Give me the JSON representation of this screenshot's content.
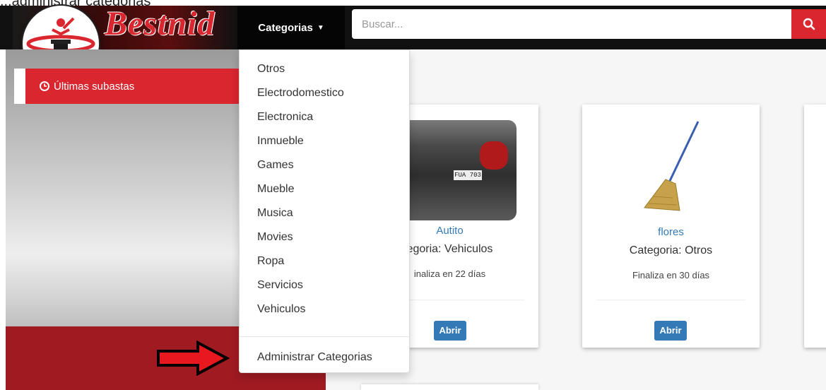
{
  "caption_fragment": "...administrar categorias",
  "brand": {
    "name": "Bestnid"
  },
  "navbar": {
    "categories_label": "Categorias",
    "search_placeholder": "Buscar..."
  },
  "sidebar": {
    "latest_label": "Últimas subastas"
  },
  "dropdown": {
    "items": [
      "Otros",
      "Electrodomestico",
      "Electronica",
      "Inmueble",
      "Games",
      "Mueble",
      "Musica",
      "Movies",
      "Ropa",
      "Servicios",
      "Vehiculos"
    ],
    "admin_label": "Administrar Categorias"
  },
  "cards": [
    {
      "title": "Autito",
      "category": "egoria: Vehiculos",
      "ends": "inaliza en 22 días",
      "button": "Abrir"
    },
    {
      "title": "flores",
      "category": "Categoria: Otros",
      "ends": "Finaliza en 30 días",
      "button": "Abrir"
    }
  ],
  "colors": {
    "brand_red": "#d9262f",
    "link_blue": "#337ab7",
    "navbar_bg": "#111111"
  },
  "icons": {
    "search": "search-icon",
    "clock": "clock-icon",
    "caret": "caret-down-icon",
    "arrow": "right-arrow-icon"
  }
}
